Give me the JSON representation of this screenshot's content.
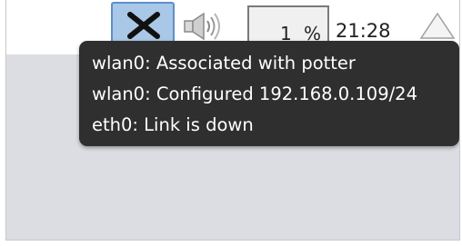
{
  "taskbar": {
    "network_icon": "wireless-disconnected-x-icon",
    "volume_icon": "speaker-volume-icon",
    "cpu_monitor": {
      "value": "1",
      "unit": "%"
    },
    "clock": "21:28",
    "eject_icon": "eject-triangle-icon"
  },
  "tooltip": {
    "lines": [
      "wlan0: Associated with potter",
      "wlan0: Configured 192.168.0.109/24",
      "eth0: Link is down"
    ]
  },
  "colors": {
    "taskbar_bg": "#ffffff",
    "desktop_bg": "#dcdde3",
    "tooltip_bg": "#2f2f2f",
    "tooltip_text": "#ffffff",
    "network_button_bg": "#a9c7e6",
    "network_button_border": "#5e8fc8"
  }
}
